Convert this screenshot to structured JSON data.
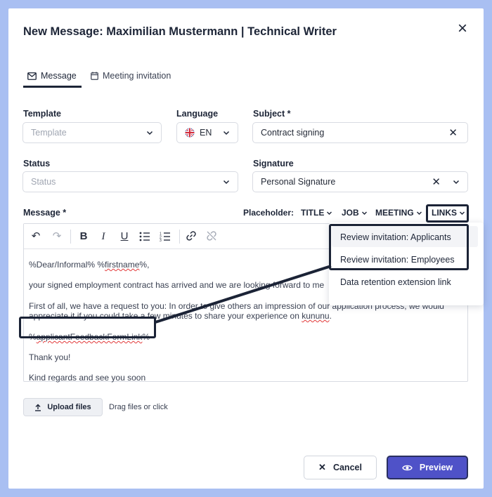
{
  "dialog": {
    "title": "New Message: Maximilian Mustermann | Technical Writer"
  },
  "tabs": [
    {
      "label": "Message",
      "icon": "envelope-icon",
      "active": true
    },
    {
      "label": "Meeting invitation",
      "icon": "calendar-icon",
      "active": false
    }
  ],
  "form": {
    "template": {
      "label": "Template",
      "placeholder": "Template"
    },
    "language": {
      "label": "Language",
      "value": "EN",
      "flag": "uk-flag-icon"
    },
    "subject": {
      "label": "Subject",
      "required_mark": "*",
      "value": "Contract signing"
    },
    "status": {
      "label": "Status",
      "placeholder": "Status"
    },
    "signature": {
      "label": "Signature",
      "value": "Personal Signature"
    }
  },
  "message": {
    "label": "Message",
    "required_mark": "*",
    "placeholder_label": "Placeholder:",
    "placeholder_menus": [
      "TITLE",
      "JOB",
      "MEETING",
      "LINKS"
    ],
    "lines": {
      "greeting_a": "%Dear/Informal% %",
      "greeting_b": "firstname",
      "greeting_c": "%,",
      "line2": "your signed employment contract has arrived and we are looking forward to me",
      "line3a": "First of all, we have a request to you: In order to give others an impression of our application process, we would",
      "line3b_a": "appreciate it if you could take a few minutes to share your experience on ",
      "line3b_b": "kununu",
      "line3b_c": ".",
      "feedback_a": "%",
      "feedback_b": "applicantFeedbackFormLink",
      "feedback_c": "%",
      "thanks": "Thank you!",
      "closing": "Kind regards and see you soon"
    }
  },
  "links_menu": {
    "items": [
      "Review invitation: Applicants",
      "Review invitation: Employees",
      "Data retention extension link"
    ]
  },
  "upload": {
    "button_label": "Upload files",
    "hint": "Drag files or click"
  },
  "footer": {
    "cancel_label": "Cancel",
    "preview_label": "Preview"
  },
  "colors": {
    "backdrop": "#a9bff2",
    "primary_button": "#4f52c8",
    "highlight_outline": "#1b2336"
  }
}
